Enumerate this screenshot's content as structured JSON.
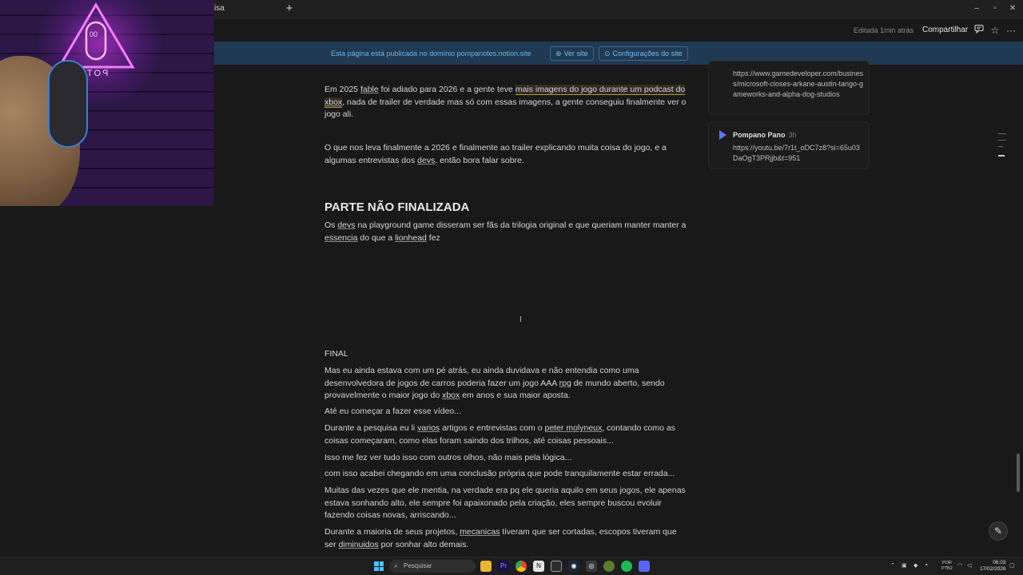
{
  "browser": {
    "tab_fragment": "isa",
    "new_tab": "+",
    "controls": {
      "minimize": "–",
      "maximize": "▫",
      "close": "✕"
    }
  },
  "topbar": {
    "edited": "Editada 1min atrás",
    "share": "Compartilhar"
  },
  "banner": {
    "text": "Esta página está publicada no domínio pompanotes.notion.site",
    "view_site": "Ver site",
    "settings": "Configurações do site"
  },
  "webcam": {
    "sign_text": "POTATO",
    "glyph": "00"
  },
  "doc": {
    "p1_pre": "Em 2025 ",
    "p1_fable": "fable",
    "p1_mid": " foi adiado para 2026 e a gente teve ",
    "p1_highlight": "mais imagens do jogo durante um podcast do ",
    "p1_xbox": "xbox",
    "p1_post": ", nada de trailer de verdade mas só com essas imagens, a gente conseguiu finalmente ver o jogo ali.",
    "p2_pre": "O que nos leva finalmente a 2026 e finalmente ao trailer explicando muita coisa do jogo, e a algumas entrevistas dos ",
    "p2_devs": "devs",
    "p2_post": ". então bora falar sobre.",
    "heading": "PARTE NÃO FINALIZADA",
    "p3_a": "Os ",
    "p3_devs": "devs",
    "p3_b": " na playground game disseram ser fãs da trilogia original e que queriam manter manter a ",
    "p3_essencia": "essencia",
    "p3_c": " do que a ",
    "p3_lionhead": "lionhead",
    "p3_d": " fez",
    "final_label": "FINAL",
    "f1_a": "Mas eu ainda estava com um pé atrás, eu ainda duvidava e não entendia como uma desenvolvedora de jogos de carros poderia fazer um jogo AAA ",
    "f1_rpg": "rpg",
    "f1_b": " de mundo aberto, sendo provavelmente o maior jogo do ",
    "f1_xbox": "xbox",
    "f1_c": " em anos e sua maior aposta.",
    "f2": "Até eu começar a fazer esse vídeo...",
    "f3_a": "Durante a pesquisa eu li ",
    "f3_varios": "varios",
    "f3_b": " artigos e entrevistas com o ",
    "f3_peter": "peter molyneux",
    "f3_c": ", contando como as coisas começaram, como elas foram saindo dos trilhos, até coisas pessoais...",
    "f4": "Isso me fez ver tudo isso com outros olhos, não mais pela lógica...",
    "f5": "com isso acabei chegando em uma conclusão própria que pode tranquilamente estar errada...",
    "f6": "Muitas das vezes que ele mentia, na verdade era pq ele queria aquilo em seus jogos, ele apenas estava sonhando alto, ele sempre foi apaixonado pela criação, eles sempre buscou evoluir fazendo coisas novas, arriscando...",
    "f7_a": "Durante a maioria de seus projetos, ",
    "f7_mecanicas": "mecanicas",
    "f7_b": " tiveram que ser cortadas, escopos tiveram que ser ",
    "f7_diminuidos": "diminuidos",
    "f7_c": " por sonhar alto demais."
  },
  "comments": [
    {
      "author": "",
      "time": "",
      "link": "https://www.gamedeveloper.com/business/microsoft-closes-arkane-austin-tango-gameworks-and-alpha-dog-studios"
    },
    {
      "author": "Pompano Pano",
      "time": "3h",
      "link": "https://youtu.be/7r1t_oDC7z8?si=65u03DaOgT3PRjjb&t=951"
    }
  ],
  "taskbar": {
    "search_placeholder": "Pesquisar",
    "lang_top": "POR",
    "lang_bottom": "PTB2",
    "time": "06:03",
    "date": "17/02/2026"
  },
  "colors": {
    "banner_bg": "#1f3a52",
    "banner_text": "#6cb1ea",
    "page_bg": "#191919"
  }
}
